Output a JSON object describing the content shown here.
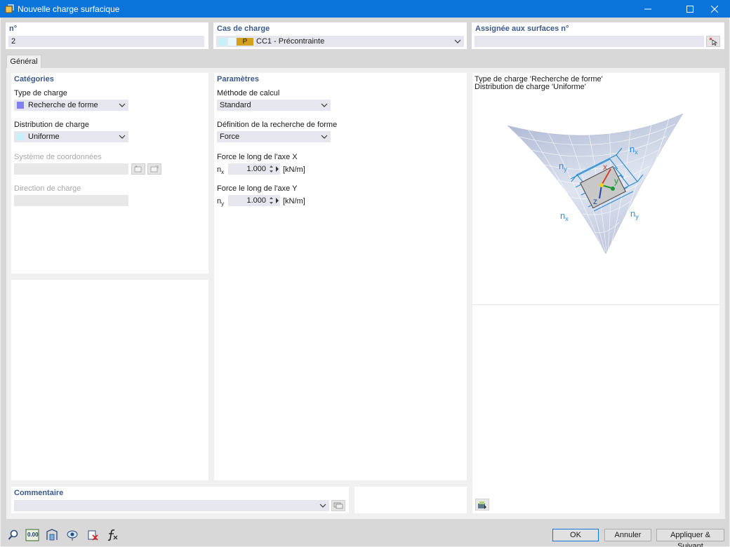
{
  "window": {
    "title": "Nouvelle charge surfacique"
  },
  "header": {
    "no_label": "n°",
    "no_value": "2",
    "loadcase_label": "Cas de charge",
    "loadcase_badge": "P",
    "loadcase_value": "CC1 - Précontrainte",
    "assigned_label": "Assignée aux surfaces n°",
    "assigned_value": ""
  },
  "tabs": [
    {
      "label": "Général"
    }
  ],
  "categories": {
    "title": "Catégories",
    "load_type_label": "Type de charge",
    "load_type_value": "Recherche de forme",
    "load_type_color": "#8080f0",
    "distribution_label": "Distribution de charge",
    "distribution_value": "Uniforme",
    "distribution_color": "#c8f0f8",
    "coord_label": "Système de coordonnées",
    "direction_label": "Direction de charge"
  },
  "parameters": {
    "title": "Paramètres",
    "method_label": "Méthode de calcul",
    "method_value": "Standard",
    "definition_label": "Définition de la recherche de forme",
    "definition_value": "Force",
    "force_x_label": "Force le long de l'axe X",
    "nx_symbol": "n",
    "nx_sub": "x",
    "nx_value": "1.000",
    "nx_unit": "[kN/m]",
    "force_y_label": "Force le long de l'axe Y",
    "ny_symbol": "n",
    "ny_sub": "y",
    "ny_value": "1.000",
    "ny_unit": "[kN/m]"
  },
  "preview": {
    "line1": "Type de charge 'Recherche de forme'",
    "line2": "Distribution de charge 'Uniforme'",
    "labels": {
      "nx": "n",
      "x_sub": "x",
      "ny": "n",
      "y_sub": "y",
      "axis_x": "x",
      "axis_y": "y",
      "axis_z": "z"
    }
  },
  "comment": {
    "label": "Commentaire",
    "value": ""
  },
  "footer": {
    "ok": "OK",
    "cancel": "Annuler",
    "apply_next": "Appliquer & Suivant"
  },
  "toolbar": {
    "zero_label": "0.00"
  }
}
